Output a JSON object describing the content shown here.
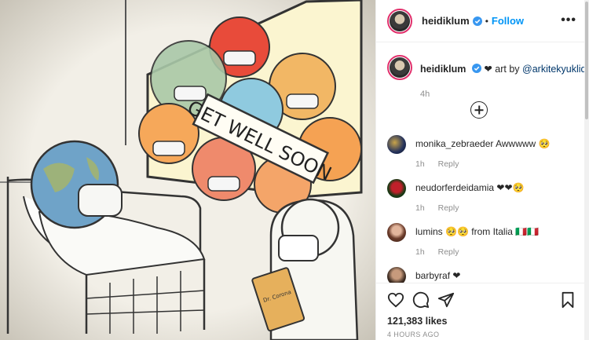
{
  "header": {
    "username": "heidiklum",
    "separator": "•",
    "follow_label": "Follow",
    "more_label": "•••"
  },
  "caption": {
    "username": "heidiklum",
    "heart": "❤",
    "text_prefix": "art by",
    "mention": "@arkitekyuklid",
    "time": "4h"
  },
  "comments": [
    {
      "username": "monika_zebraeder",
      "text": "Awwwww 🥺",
      "time": "1h",
      "reply_label": "Reply"
    },
    {
      "username": "neudorferdeidamia",
      "text": "❤❤🥺",
      "time": "1h",
      "reply_label": "Reply"
    },
    {
      "username": "lumins",
      "text": "🥺🥺 from Italia 🇮🇹🇮🇹",
      "time": "1h",
      "reply_label": "Reply"
    },
    {
      "username": "barbyraf",
      "text": "❤",
      "time": "",
      "reply_label": ""
    }
  ],
  "footer": {
    "likes": "121,383 likes",
    "posted": "4 HOURS AGO"
  },
  "image": {
    "sign_text": "GET WELL SOON",
    "clipboard_text": "Dr. Corona"
  },
  "colors": {
    "follow": "#0095f6",
    "verified": "#3897f0",
    "story_ring": "#e1306c"
  }
}
